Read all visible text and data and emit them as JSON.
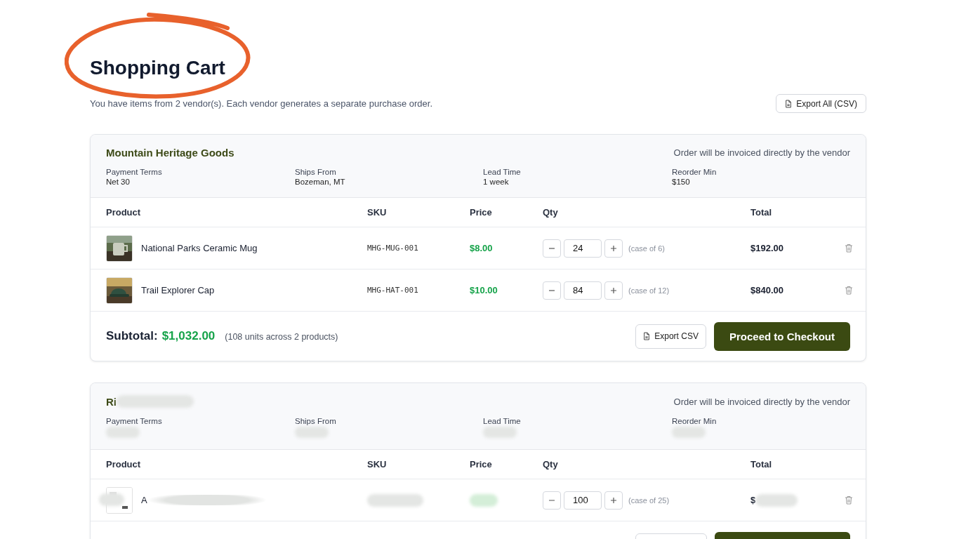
{
  "page": {
    "title": "Shopping Cart",
    "subtitle": "You have items from 2 vendor(s). Each vendor generates a separate purchase order.",
    "export_all": "Export All (CSV)"
  },
  "annotation": {
    "kind": "circle",
    "color": "#e8612c"
  },
  "vendors": [
    {
      "name": "Mountain Heritage Goods",
      "redacted": false,
      "note": "Order will be invoiced directly by the vendor",
      "columns": [
        "Product",
        "SKU",
        "Price",
        "Qty",
        "Total"
      ],
      "details": [
        {
          "label": "Payment Terms",
          "value": "Net 30"
        },
        {
          "label": "Ships From",
          "value": "Bozeman, MT"
        },
        {
          "label": "Lead Time",
          "value": "1 week"
        },
        {
          "label": "Reorder Min",
          "value": "$150"
        }
      ],
      "items": [
        {
          "name": "National Parks Ceramic Mug",
          "sku": "MHG-MUG-001",
          "price": "$8.00",
          "qty": "24",
          "case": "(case of 6)",
          "total": "$192.00",
          "redacted": false
        },
        {
          "name": "Trail Explorer Cap",
          "sku": "MHG-HAT-001",
          "price": "$10.00",
          "qty": "84",
          "case": "(case of 12)",
          "total": "$840.00",
          "redacted": false
        }
      ],
      "footer": {
        "label": "Subtotal:",
        "amount": "$1,032.00",
        "units": "(108 units across 2 products)",
        "export": "Export CSV",
        "checkout": "Proceed to Checkout"
      }
    },
    {
      "name": "Ri",
      "redacted": true,
      "note": "Order will be invoiced directly by the vendor",
      "columns": [
        "Product",
        "SKU",
        "Price",
        "Qty",
        "Total"
      ],
      "details": [
        {
          "label": "Payment Terms"
        },
        {
          "label": "Ships From"
        },
        {
          "label": "Lead Time"
        },
        {
          "label": "Reorder Min"
        }
      ],
      "items": [
        {
          "name": "A",
          "qty": "100",
          "case": "(case of 25)",
          "total": "$",
          "redacted": true
        }
      ]
    }
  ]
}
